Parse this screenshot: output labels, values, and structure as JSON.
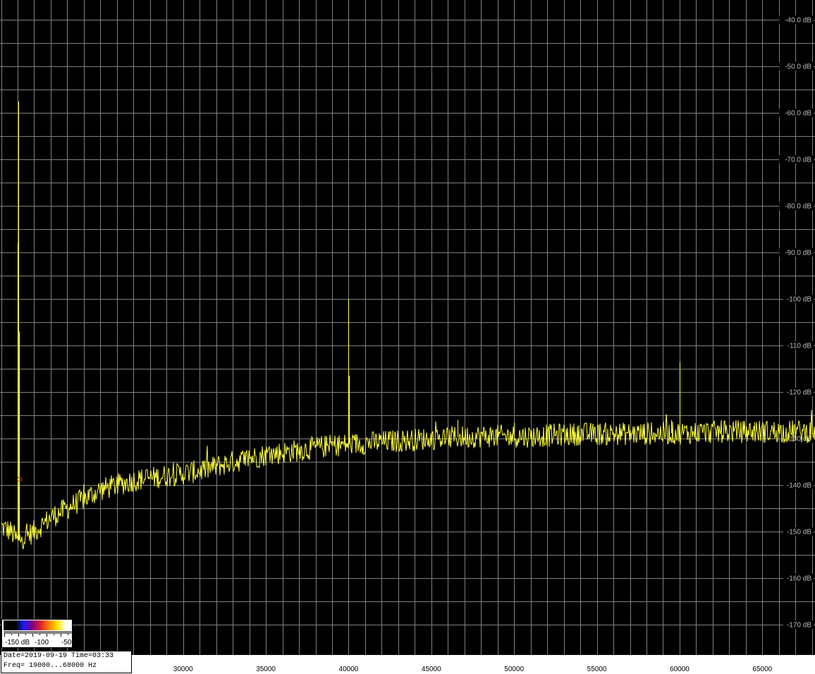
{
  "chart_data": {
    "type": "line",
    "xlim": [
      19000,
      68000
    ],
    "ylim": [
      -175,
      -35
    ],
    "x_ticks": [
      "30000",
      "35000",
      "40000",
      "45000",
      "50000",
      "55000",
      "60000",
      "65000"
    ],
    "y_ticks": [
      "-40.0 dB",
      "-50.0 dB",
      "-60.0 dB",
      "-70.0 dB",
      "-80.0 dB",
      "-90.0 dB",
      "-100 dB",
      "-110 dB",
      "-120 dB",
      "-130 dB",
      "-140 dB",
      "-150 dB",
      "-160 dB",
      "-170 dB"
    ],
    "grid": true,
    "colors": {
      "trace": "#ffff40",
      "grid": "#808080",
      "background": "#000000",
      "marker": "#ff2020"
    },
    "noise_floor": [
      {
        "x": 19000,
        "y": -149
      },
      {
        "x": 19600,
        "y": -150
      },
      {
        "x": 20000,
        "y": -152
      },
      {
        "x": 21000,
        "y": -150
      },
      {
        "x": 22000,
        "y": -147
      },
      {
        "x": 23000,
        "y": -145
      },
      {
        "x": 24000,
        "y": -143
      },
      {
        "x": 25000,
        "y": -141
      },
      {
        "x": 27000,
        "y": -139
      },
      {
        "x": 29000,
        "y": -138
      },
      {
        "x": 31000,
        "y": -137
      },
      {
        "x": 33000,
        "y": -135
      },
      {
        "x": 35000,
        "y": -133.5
      },
      {
        "x": 37000,
        "y": -132.5
      },
      {
        "x": 39000,
        "y": -131.5
      },
      {
        "x": 41000,
        "y": -131
      },
      {
        "x": 43000,
        "y": -130.5
      },
      {
        "x": 45000,
        "y": -130
      },
      {
        "x": 48000,
        "y": -129.5
      },
      {
        "x": 51000,
        "y": -129.5
      },
      {
        "x": 54000,
        "y": -129
      },
      {
        "x": 57000,
        "y": -129
      },
      {
        "x": 60000,
        "y": -128.8
      },
      {
        "x": 63000,
        "y": -128.5
      },
      {
        "x": 66000,
        "y": -128.5
      },
      {
        "x": 68000,
        "y": -128.5
      }
    ],
    "peaks": [
      {
        "x": 20050,
        "y": -57.5
      },
      {
        "x": 20000,
        "y": -88
      },
      {
        "x": 20080,
        "y": -107
      },
      {
        "x": 40000,
        "y": -100
      },
      {
        "x": 40010,
        "y": -116.5
      },
      {
        "x": 60000,
        "y": -113.5
      },
      {
        "x": 59500,
        "y": -126
      },
      {
        "x": 46600,
        "y": -126
      },
      {
        "x": 50000,
        "y": -126.5
      },
      {
        "x": 64500,
        "y": -126.5
      }
    ],
    "marker": {
      "x": 20120,
      "y": -138.8
    }
  },
  "legend": {
    "low_label": "-150 dB",
    "mid_label": "-100",
    "high_label": "-50"
  },
  "info": {
    "date_line": "Date=2019-09-19 Time=03:33",
    "freq_line": "Freq= 19000...68000 Hz"
  }
}
